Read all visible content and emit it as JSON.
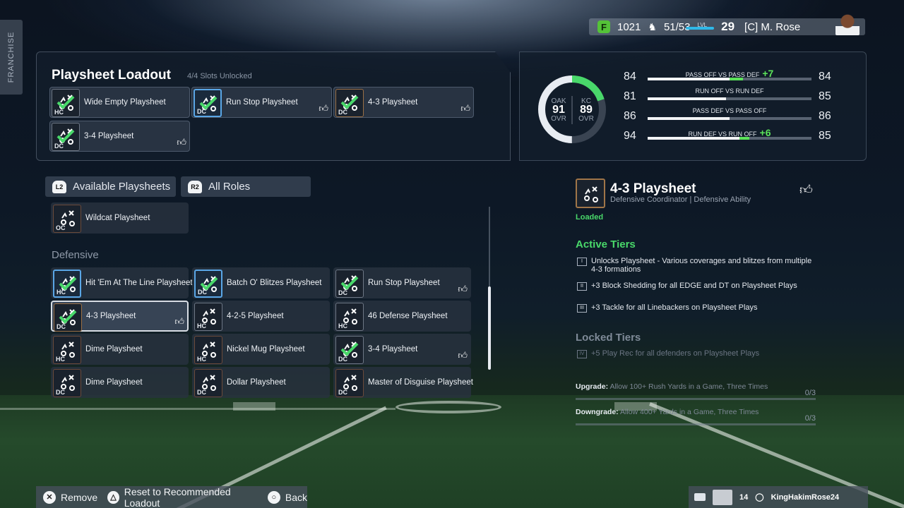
{
  "side_tab": {
    "label": "FRANCHISE"
  },
  "top_bar": {
    "coins": "1021",
    "team_rating": "51/53",
    "level_label": "LVL",
    "level": "29",
    "user": "[C] M. Rose"
  },
  "loadout": {
    "title": "Playsheet Loadout",
    "subtitle": "4/4 Slots Unlocked",
    "slots": [
      {
        "label": "Wide Empty Playsheet",
        "tag": "HC",
        "liked": false
      },
      {
        "label": "Run Stop Playsheet",
        "tag": "DC",
        "liked": true
      },
      {
        "label": "4-3 Playsheet",
        "tag": "DC",
        "liked": true
      },
      {
        "label": "3-4 Playsheet",
        "tag": "DC",
        "liked": true
      }
    ]
  },
  "filters": {
    "l2_badge": "L2",
    "available_label": "Available Playsheets",
    "r2_badge": "R2",
    "roles_label": "All Roles"
  },
  "offensive_items": [
    {
      "label": "Wildcat Playsheet",
      "tag": "OC"
    }
  ],
  "section_defensive": "Defensive",
  "defensive_items": [
    {
      "label": "Hit 'Em At The Line Playsheet",
      "tag": "HC"
    },
    {
      "label": "Batch O' Blitzes Playsheet",
      "tag": "DC"
    },
    {
      "label": "Run Stop Playsheet",
      "tag": "DC"
    },
    {
      "label": "4-3 Playsheet",
      "tag": "DC"
    },
    {
      "label": "4-2-5 Playsheet",
      "tag": "HC"
    },
    {
      "label": "46 Defense Playsheet",
      "tag": "HC"
    },
    {
      "label": "Dime Playsheet",
      "tag": "HC"
    },
    {
      "label": "Nickel Mug Playsheet",
      "tag": "HC"
    },
    {
      "label": "3-4 Playsheet",
      "tag": "DC"
    },
    {
      "label": "Dime Playsheet",
      "tag": "DC"
    },
    {
      "label": "Dollar Playsheet",
      "tag": "DC"
    },
    {
      "label": "Master of Disguise Playsheet",
      "tag": "DC"
    }
  ],
  "matchup": {
    "left_team": "OAK",
    "left_ovr": "91",
    "left_ovr_label": "OVR",
    "right_team": "KC",
    "right_ovr": "89",
    "right_ovr_label": "OVR",
    "rows": [
      {
        "left": "84",
        "label": "PASS OFF VS PASS DEF",
        "delta": "+7",
        "right": "84",
        "left_frac": 0.5,
        "gain_frac": 0.08
      },
      {
        "left": "81",
        "label": "RUN OFF VS RUN DEF",
        "delta": "",
        "right": "85",
        "left_frac": 0.48,
        "gain_frac": 0
      },
      {
        "left": "86",
        "label": "PASS DEF VS PASS OFF",
        "delta": "",
        "right": "86",
        "left_frac": 0.5,
        "gain_frac": 0
      },
      {
        "left": "94",
        "label": "RUN DEF VS RUN OFF",
        "delta": "+6",
        "right": "85",
        "left_frac": 0.56,
        "gain_frac": 0.06
      }
    ]
  },
  "detail": {
    "title": "4-3 Playsheet",
    "subtitle": "Defensive Coordinator | Defensive Ability",
    "status": "Loaded",
    "active_heading": "Active Tiers",
    "active_tiers": [
      {
        "num": "I",
        "text": "Unlocks Playsheet - Various coverages and blitzes from multiple 4-3 formations"
      },
      {
        "num": "II",
        "text": "+3 Block Shedding for all EDGE and DT on Playsheet Plays"
      },
      {
        "num": "III",
        "text": "+3 Tackle for all Linebackers on Playsheet Plays"
      }
    ],
    "locked_heading": "Locked Tiers",
    "locked_tiers": [
      {
        "num": "IV",
        "text": "+5 Play Rec for all defenders on Playsheet Plays"
      }
    ],
    "upgrade_label": "Upgrade:",
    "upgrade_text": "Allow 100+ Rush Yards in a Game, Three Times",
    "upgrade_count": "0/3",
    "downgrade_label": "Downgrade:",
    "downgrade_text": "Allow 400+ Yards in a Game, Three Times",
    "downgrade_count": "0/3"
  },
  "bottom_bar": {
    "remove": "Remove",
    "reset": "Reset to Recommended Loadout",
    "back": "Back"
  },
  "user_tag": {
    "count": "14",
    "gamertag": "KingHakimRose24"
  },
  "colors": {
    "accent_green": "#49d86a",
    "gain_green": "#5ce35a",
    "coin_green": "#54c238",
    "level_blue": "#2fb8e8"
  }
}
